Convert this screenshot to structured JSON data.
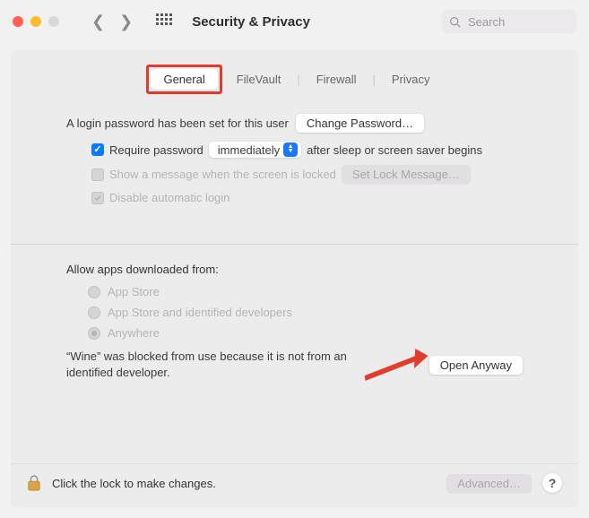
{
  "toolbar": {
    "title": "Security & Privacy",
    "search_placeholder": "Search"
  },
  "tabs": {
    "general": "General",
    "filevault": "FileVault",
    "firewall": "Firewall",
    "privacy": "Privacy"
  },
  "general": {
    "login_password_text": "A login password has been set for this user",
    "change_password_btn": "Change Password…",
    "require_password_label": "Require password",
    "require_password_select": "immediately",
    "require_password_after": "after sleep or screen saver begins",
    "show_message_label": "Show a message when the screen is locked",
    "set_lock_message_btn": "Set Lock Message…",
    "disable_auto_login_label": "Disable automatic login"
  },
  "allow": {
    "heading": "Allow apps downloaded from:",
    "app_store": "App Store",
    "app_store_identified": "App Store and identified developers",
    "anywhere": "Anywhere",
    "blocked_text": "“Wine” was blocked from use because it is not from an identified developer.",
    "open_anyway_btn": "Open Anyway"
  },
  "footer": {
    "lock_text": "Click the lock to make changes.",
    "advanced_btn": "Advanced…",
    "help": "?"
  }
}
